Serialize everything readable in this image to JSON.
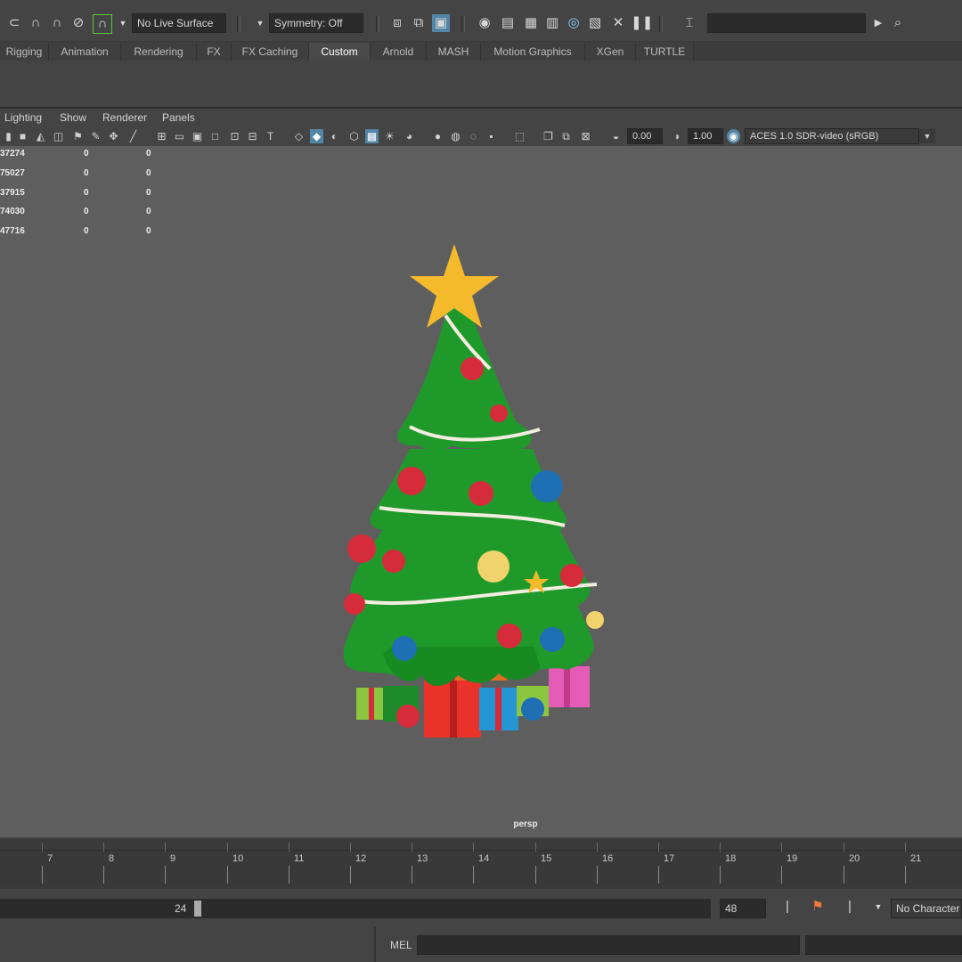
{
  "toolbar": {
    "live_surface": "No Live Surface",
    "symmetry": "Symmetry: Off"
  },
  "shelf_tabs": [
    "Rigging",
    "Animation",
    "Rendering",
    "FX",
    "FX Caching",
    "Custom",
    "Arnold",
    "MASH",
    "Motion Graphics",
    "XGen",
    "TURTLE"
  ],
  "active_shelf": "Custom",
  "viewport_menu": [
    "Lighting",
    "Show",
    "Renderer",
    "Panels"
  ],
  "viewport_toolbar": {
    "exposure": "0.00",
    "gamma": "1.00",
    "color_space": "ACES 1.0 SDR-video (sRGB)"
  },
  "hud": [
    [
      "37274",
      "0",
      "0"
    ],
    [
      "75027",
      "0",
      "0"
    ],
    [
      "37915",
      "0",
      "0"
    ],
    [
      "74030",
      "0",
      "0"
    ],
    [
      "47716",
      "0",
      "0"
    ]
  ],
  "camera_label": "persp",
  "timeline": {
    "ticks": [
      "7",
      "8",
      "9",
      "10",
      "11",
      "12",
      "13",
      "14",
      "15",
      "16",
      "17",
      "18",
      "19",
      "20",
      "21"
    ]
  },
  "range": {
    "current": "24",
    "end": "48",
    "character_set": "No Character"
  },
  "command_line": {
    "language": "MEL"
  },
  "colors": {
    "accent": "#5285a6",
    "viewport_bg": "#5e5e5e",
    "tree_green": "#1f9a2a",
    "star_yellow": "#f5b92c",
    "ornament_red": "#d62b3a",
    "ornament_blue": "#1f6fb5"
  }
}
